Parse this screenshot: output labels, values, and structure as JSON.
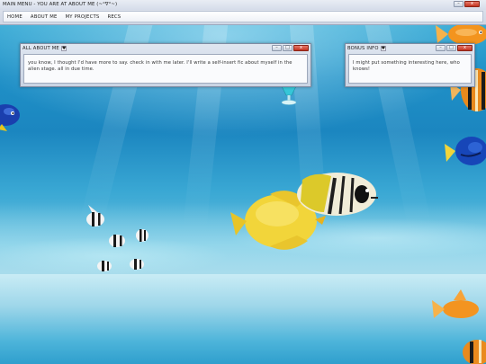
{
  "window": {
    "title": "MAIN MENU - YOU ARE AT ABOUT ME (~°∇°~)"
  },
  "menu": {
    "items": [
      {
        "label": "HOME"
      },
      {
        "label": "ABOUT ME"
      },
      {
        "label": "MY PROJECTS"
      },
      {
        "label": "RECS"
      }
    ]
  },
  "windows": {
    "about": {
      "title": "ALL ABOUT ME",
      "title_icon": "heart-icon",
      "body": "you know, I thought I'd have more to say. check in with me later. I'll write a self-insert fic about myself in the alien stage. all in due time."
    },
    "bonus": {
      "title": "BONUS INFO",
      "title_icon": "heart-icon",
      "body": "I might put something interesting here, who knows!"
    }
  },
  "controls": {
    "minimize": "–",
    "maximize": "□",
    "close": "x"
  },
  "colors": {
    "accent_close": "#c3321f",
    "water": "#1f90c7",
    "fish_yellow": "#f2d53a",
    "fish_orange": "#f3941e",
    "fish_blue": "#1746b8"
  }
}
